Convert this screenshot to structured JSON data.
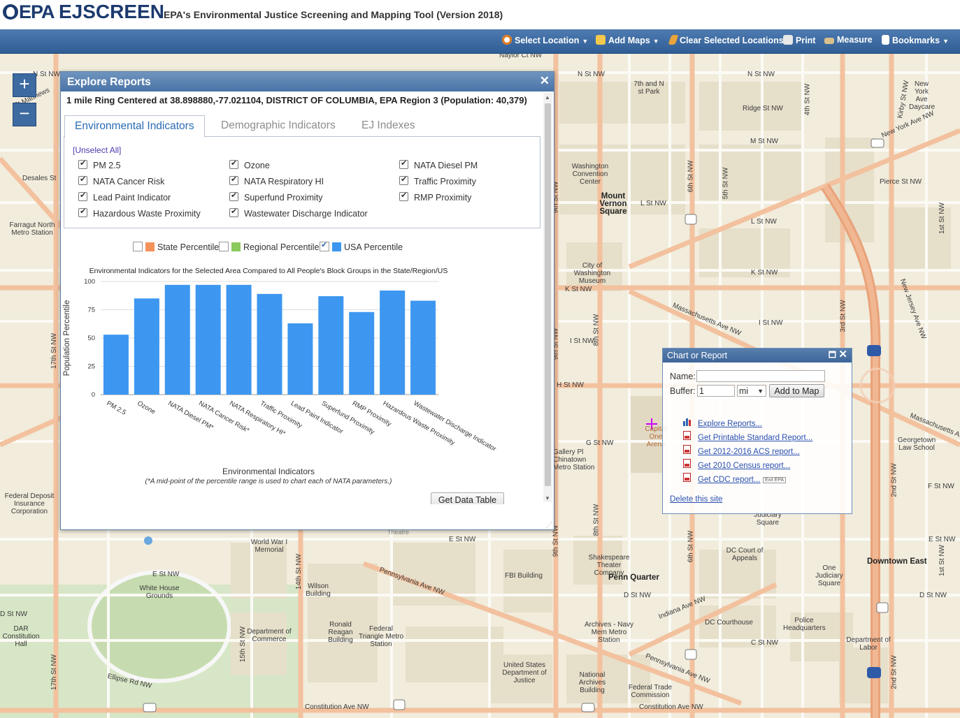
{
  "header": {
    "logo_text": "EPA",
    "app_name": "EJSCREEN",
    "subtitle": "EPA's Environmental Justice Screening and Mapping Tool (Version 2018)"
  },
  "toolbar": {
    "select_location": "Select Location",
    "add_maps": "Add Maps",
    "clear_selected": "Clear Selected Locations",
    "print": "Print",
    "measure": "Measure",
    "bookmarks": "Bookmarks"
  },
  "zoom": {
    "in_label": "+",
    "out_label": "−"
  },
  "dialog": {
    "title": "Explore Reports",
    "close_label": "✕",
    "area_description": "1 mile Ring Centered at 38.898880,-77.021104, DISTRICT OF COLUMBIA, EPA Region 3 (Population: 40,379)",
    "tabs": [
      "Environmental Indicators",
      "Demographic Indicators",
      "EJ Indexes"
    ],
    "active_tab": "Environmental Indicators",
    "unselect_all": "[Unselect All]",
    "checkboxes": [
      "PM 2.5",
      "Ozone",
      "NATA Diesel PM",
      "NATA Cancer Risk",
      "NATA Respiratory HI",
      "Traffic Proximity",
      "Lead Paint Indicator",
      "Superfund Proximity",
      "RMP Proximity",
      "Hazardous Waste Proximity",
      "Wastewater Discharge Indicator"
    ],
    "legend": [
      {
        "label": "State Percentile",
        "color": "#f4925a",
        "checked": false
      },
      {
        "label": "Regional Percentile",
        "color": "#8cc95c",
        "checked": false
      },
      {
        "label": "USA Percentile",
        "color": "#3d97f0",
        "checked": true
      }
    ],
    "get_data_table": "Get Data Table"
  },
  "chart_data": {
    "type": "bar",
    "title": "Environmental Indicators for the Selected Area Compared to All People's Block Groups in the State/Region/US",
    "xlabel": "Environmental Indicators",
    "ylabel": "Population Percentile",
    "footnote": "(*A mid-point of the percentile range is used to chart each of NATA parameters.)",
    "categories": [
      "PM 2.5",
      "Ozone",
      "NATA Diesel PM*",
      "NATA Cancer Risk*",
      "NATA Respiratory HI*",
      "Traffic Proximity",
      "Lead Paint Indicator",
      "Superfund Proximity",
      "RMP Proximity",
      "Hazardous Waste Proximity",
      "Wastewater Discharge Indicator"
    ],
    "series": [
      {
        "name": "USA Percentile",
        "color": "#3d97f0",
        "values": [
          53,
          85,
          97,
          97,
          97,
          89,
          63,
          87,
          73,
          92,
          83
        ]
      }
    ],
    "yticks": [
      0,
      25,
      50,
      75,
      100
    ],
    "ylim": [
      0,
      100
    ],
    "grid": true
  },
  "report_panel": {
    "title": "Chart or Report",
    "max_label": "🗖",
    "close_label": "✕",
    "name_label": "Name:",
    "name_value": "",
    "buffer_label": "Buffer:",
    "buffer_value": "1",
    "unit": "mi",
    "add_to_map": "Add to Map",
    "links": [
      "Explore Reports...",
      "Get Printable Standard Report...",
      "Get 2012-2016 ACS report...",
      "Get 2010 Census report...",
      "Get CDC report..."
    ],
    "exit_epa": "Exit EPA",
    "delete_site": "Delete this site"
  },
  "map_labels": {
    "n_st_nw": "N St NW",
    "naylor_ct": "Naylor Ct NW",
    "seventh_n": "7th and N st Park",
    "washington_convention": "Washington Convention Center",
    "mount_vernon": "Mount Vernon Square",
    "l_st_nw": "L St NW",
    "m_st_nw": "M St NW",
    "ridge_st": "Ridge St NW",
    "pierce_st": "Pierce St NW",
    "new_york_ave": "New York Ave NW",
    "new_york_daycare": "New York Ave Daycare",
    "city_museum": "City of Washington Museum",
    "k_st_nw": "K St NW",
    "i_st_nw": "I St NW",
    "massachusetts": "Massachusetts Ave NW",
    "new_jersey": "New Jersey Ave NW",
    "h_st_nw": "H St NW",
    "g_st_nw": "G St NW",
    "f_st_nw": "F St NW",
    "e_st_nw": "E St NW",
    "d_st_nw": "D St NW",
    "c_st_nw": "C St NW",
    "georgetown_law": "Georgetown Law School",
    "downtown_east": "Downtown East",
    "penn_quarter": "Penn Quarter",
    "shakespeare": "Shakespeare Theater Company",
    "fbi": "FBI Building",
    "pennsylvania_ave": "Pennsylvania Ave NW",
    "indiana_ave": "Indiana Ave NW",
    "dc_courthouse": "DC Courthouse",
    "police_hq": "Police Headquarters",
    "dc_court_appeals": "DC Court of Appeals",
    "one_judiciary": "One Judiciary Square",
    "judiciary_square": "Judiciary Square",
    "archives": "Archives - Navy Mem Metro Station",
    "national_archives": "National Archives Building",
    "federal_trade": "Federal Trade Commission",
    "dept_labor": "Department of Labor",
    "us_states_justice": "United States Department of Justice",
    "federal_triangle": "Federal Triangle Metro Station",
    "ronald_reagan": "Ronald Reagan Building",
    "dept_commerce": "Department of Commerce",
    "wilson_building": "Wilson Building",
    "white_house": "White House Grounds",
    "ellipse": "Ellipse Rd NW",
    "constitution": "Constitution Ave NW",
    "world_war": "World War I Memorial",
    "dar": "DAR Constitution Hall",
    "federal_deposit": "Federal Deposit Insurance Corporation",
    "farragut": "Farragut North Metro Station",
    "desales": "Desales St",
    "st_matthews": "St Matthews",
    "gallery_place": "Gallery Pl Chinatown Metro Station",
    "e_st": "E St NW",
    "ninth_st": "9th St NW",
    "eighth_st": "8th St NW",
    "sixth_st": "6th St NW",
    "fifth_st": "5th St NW",
    "fourth_st": "4th St NW",
    "third_st": "3rd St NW",
    "second_st": "2nd St NW",
    "first_st": "1st St NW",
    "seventeenth_st": "17th St NW",
    "fifteenth_st": "15th St NW",
    "fourteenth_st": "14th St NW",
    "kirby_st": "Kirby St NW",
    "capital_one": "Capital One Arena",
    "theatre": "Theatre"
  }
}
